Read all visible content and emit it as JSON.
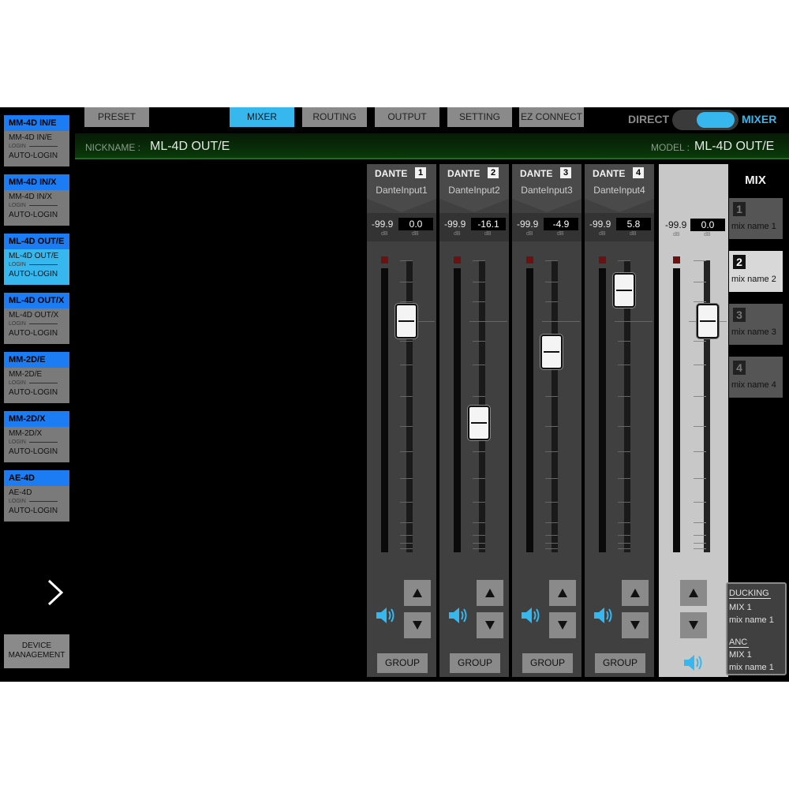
{
  "devices": [
    {
      "title": "MM-4D IN/E",
      "name": "MM-4D IN/E",
      "login": "LOGIN",
      "auto_login": "AUTO-LOGIN"
    },
    {
      "title": "MM-4D IN/X",
      "name": "MM-4D IN/X",
      "login": "LOGIN",
      "auto_login": "AUTO-LOGIN"
    },
    {
      "title": "ML-4D OUT/E",
      "name": "ML-4D OUT/E",
      "login": "LOGIN",
      "auto_login": "AUTO-LOGIN"
    },
    {
      "title": "ML-4D OUT/X",
      "name": "ML-4D OUT/X",
      "login": "LOGIN",
      "auto_login": "AUTO-LOGIN"
    },
    {
      "title": "MM-2D/E",
      "name": "MM-2D/E",
      "login": "LOGIN",
      "auto_login": "AUTO-LOGIN"
    },
    {
      "title": "MM-2D/X",
      "name": "MM-2D/X",
      "login": "LOGIN",
      "auto_login": "AUTO-LOGIN"
    },
    {
      "title": "AE-4D",
      "name": "AE-4D",
      "login": "LOGIN",
      "auto_login": "AUTO-LOGIN"
    }
  ],
  "active_device": 2,
  "device_management_line1": "DEVICE",
  "device_management_line2": "MANAGEMENT",
  "tabs": [
    "PRESET",
    "MIXER",
    "ROUTING",
    "OUTPUT",
    "SETTING",
    "EZ CONNECT"
  ],
  "active_tab": "MIXER",
  "toggle": {
    "left_label": "DIRECT",
    "right_label": "MIXER",
    "selected": "MIXER"
  },
  "nickname_label": "NICKNAME :",
  "nickname": "ML-4D OUT/E",
  "model_label": "MODEL :",
  "model": "ML-4D OUT/E",
  "channels": [
    {
      "source": "DANTE",
      "number": "1",
      "input_name": "DanteInput1",
      "peak": "-99.9",
      "gain": "0.0",
      "unit": "dB",
      "fader_db": 0.0,
      "group_label": "GROUP"
    },
    {
      "source": "DANTE",
      "number": "2",
      "input_name": "DanteInput2",
      "peak": "-99.9",
      "gain": "-16.1",
      "unit": "dB",
      "fader_db": -16.1,
      "group_label": "GROUP"
    },
    {
      "source": "DANTE",
      "number": "3",
      "input_name": "DanteInput3",
      "peak": "-99.9",
      "gain": "-4.9",
      "unit": "dB",
      "fader_db": -4.9,
      "group_label": "GROUP"
    },
    {
      "source": "DANTE",
      "number": "4",
      "input_name": "DanteInput4",
      "peak": "-99.9",
      "gain": "5.8",
      "unit": "dB",
      "fader_db": 5.8,
      "group_label": "GROUP"
    }
  ],
  "master": {
    "peak": "-99.9",
    "gain": "0.0",
    "unit": "dB",
    "fader_db": 0.0
  },
  "mix": {
    "title": "MIX",
    "buses": [
      {
        "number": "1",
        "name": "mix name 1"
      },
      {
        "number": "2",
        "name": "mix name 2"
      },
      {
        "number": "3",
        "name": "mix name 3"
      },
      {
        "number": "4",
        "name": "mix name 4"
      }
    ],
    "active": 1
  },
  "ducking": {
    "label": "DUCKING",
    "mix": "MIX 1",
    "mix_name": "mix name 1"
  },
  "anc": {
    "label": "ANC",
    "mix": "MIX 1",
    "mix_name": "mix name 1"
  },
  "colors": {
    "accent": "#36b8ef",
    "device_header": "#1b7cf3",
    "button_gray": "#8a8a8a",
    "speaker": "#36b8ef"
  },
  "icons": {
    "next": "chevron-right-icon",
    "up": "triangle-up-icon",
    "down": "triangle-down-icon",
    "speaker": "speaker-icon"
  }
}
